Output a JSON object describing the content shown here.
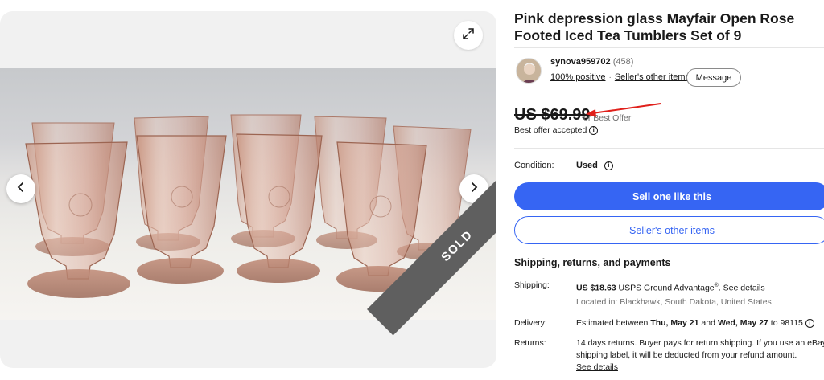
{
  "listing": {
    "title": "Pink depression glass Mayfair Open Rose Footed Iced Tea Tumblers Set of 9",
    "sold_ribbon": "SOLD"
  },
  "seller": {
    "name": "synova959702",
    "feedback_count": "(458)",
    "positive": "100% positive",
    "other_items_link": "Seller's other items",
    "message_button": "Message"
  },
  "price": {
    "amount": "US $69.99",
    "offer_label": "or Best Offer",
    "accepted": "Best offer accepted"
  },
  "condition": {
    "label": "Condition:",
    "value": "Used"
  },
  "actions": {
    "sell_one": "Sell one like this",
    "seller_other_items": "Seller's other items"
  },
  "shipping": {
    "heading": "Shipping, returns, and payments",
    "shipping_label": "Shipping:",
    "shipping_cost": "US $18.63",
    "shipping_service": "USPS Ground Advantage",
    "shipping_reg": "®",
    "see_details": "See details",
    "location": "Located in: Blackhawk, South Dakota, United States",
    "delivery_label": "Delivery:",
    "delivery_prefix": "Estimated between",
    "delivery_start": "Thu, May 21",
    "delivery_and": "and",
    "delivery_end": "Wed, May 27",
    "delivery_to": "to 98115",
    "returns_label": "Returns:",
    "returns_line1": "14 days returns. Buyer pays for return shipping. If you use an eBay",
    "returns_line2": "shipping label, it will be deducted from your refund amount.",
    "returns_details": "See details"
  },
  "icons": {
    "expand": "expand-icon",
    "prev": "chevron-left-icon",
    "next": "chevron-right-icon",
    "info": "info-icon",
    "arrow": "red-arrow-annotation"
  },
  "colors": {
    "primary": "#3665f3",
    "ribbon": "#5f5f5f",
    "annotation": "#e0201b"
  }
}
